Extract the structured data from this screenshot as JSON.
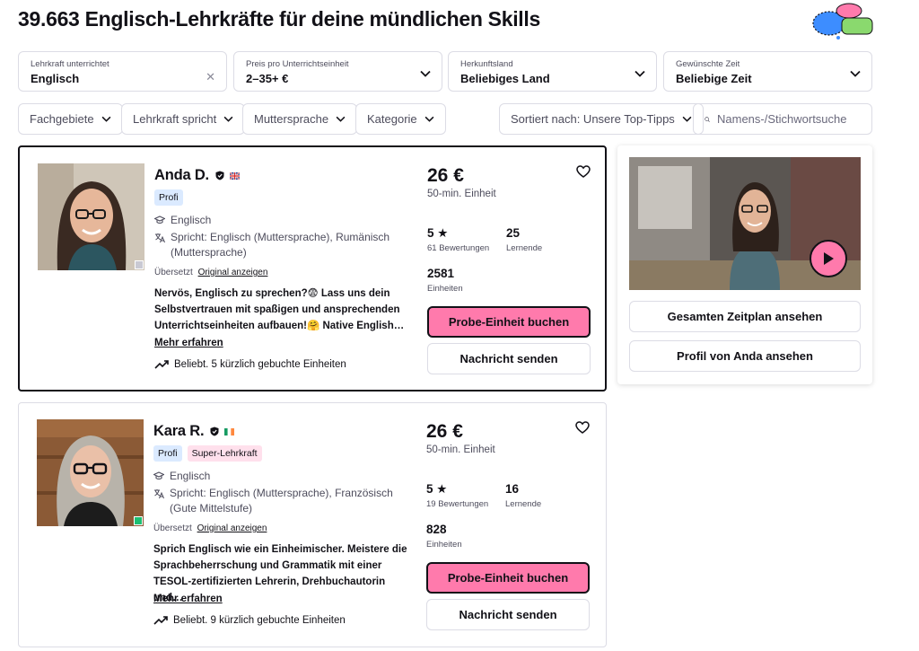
{
  "page": {
    "title": "39.663 Englisch-Lehrkräfte für deine mündlichen Skills"
  },
  "filters": [
    {
      "label": "Lehrkraft unterrichtet",
      "value": "Englisch"
    },
    {
      "label": "Preis pro Unterrichtseinheit",
      "value": "2–35+ €"
    },
    {
      "label": "Herkunftsland",
      "value": "Beliebiges Land"
    },
    {
      "label": "Gewünschte Zeit",
      "value": "Beliebige Zeit"
    }
  ],
  "chips": [
    "Fachgebiete",
    "Lehrkraft spricht",
    "Muttersprache",
    "Kategorie"
  ],
  "sort": {
    "label": "Sortiert nach: Unsere Top-Tipps"
  },
  "search": {
    "placeholder": "Namens-/Stichwortsuche"
  },
  "tutors": [
    {
      "name": "Anda D.",
      "badges": [
        "Profi"
      ],
      "subject": "Englisch",
      "languages": "Spricht: Englisch (Muttersprache), Rumänisch (Muttersprache)",
      "translated": "Übersetzt",
      "original_link": "Original anzeigen",
      "description": "Nervös, Englisch zu sprechen?😨 Lass uns dein Selbstvertrauen mit spaßigen und ansprechenden Unterrichtseinheiten aufbauen!🤗 Native English…",
      "more": "Mehr erfahren",
      "booked": "Beliebt. 5 kürzlich gebuchte Einheiten",
      "price": "26 €",
      "unit": "50-min. Einheit",
      "rating": "5",
      "reviews": "61 Bewertungen",
      "students": "25",
      "students_label": "Lernende",
      "lessons": "2581",
      "lessons_label": "Einheiten",
      "book_label": "Probe-Einheit buchen",
      "message_label": "Nachricht senden"
    },
    {
      "name": "Kara R.",
      "badges": [
        "Profi",
        "Super-Lehrkraft"
      ],
      "subject": "Englisch",
      "languages": "Spricht: Englisch (Muttersprache), Französisch (Gute Mittelstufe)",
      "translated": "Übersetzt",
      "original_link": "Original anzeigen",
      "description": "Sprich Englisch wie ein Einheimischer. Meistere die Sprachbeherrschung und Grammatik mit einer TESOL-zertifizierten Lehrerin, Drehbuchautorin und…",
      "more": "Mehr erfahren",
      "booked": "Beliebt. 9 kürzlich gebuchte Einheiten",
      "price": "26 €",
      "unit": "50-min. Einheit",
      "rating": "5",
      "reviews": "19 Bewertungen",
      "students": "16",
      "students_label": "Lernende",
      "lessons": "828",
      "lessons_label": "Einheiten",
      "book_label": "Probe-Einheit buchen",
      "message_label": "Nachricht senden"
    }
  ],
  "side_panel": {
    "schedule_label": "Gesamten Zeitplan ansehen",
    "profile_label": "Profil von Anda ansehen"
  },
  "colors": {
    "accent_pink": "#ff7aac",
    "border": "#dcdce5",
    "badge_blue": "#dbeaff",
    "badge_pink": "#ffe0ec",
    "online_green": "#1dbf73"
  },
  "icons": [
    "chat-bubbles-icon",
    "clear-icon",
    "chevron-down-icon",
    "search-icon",
    "shield-check-icon",
    "flag-uk-icon",
    "flag-ireland-icon",
    "graduation-cap-icon",
    "translate-icon",
    "star-icon",
    "heart-icon",
    "trending-up-icon",
    "play-icon"
  ]
}
